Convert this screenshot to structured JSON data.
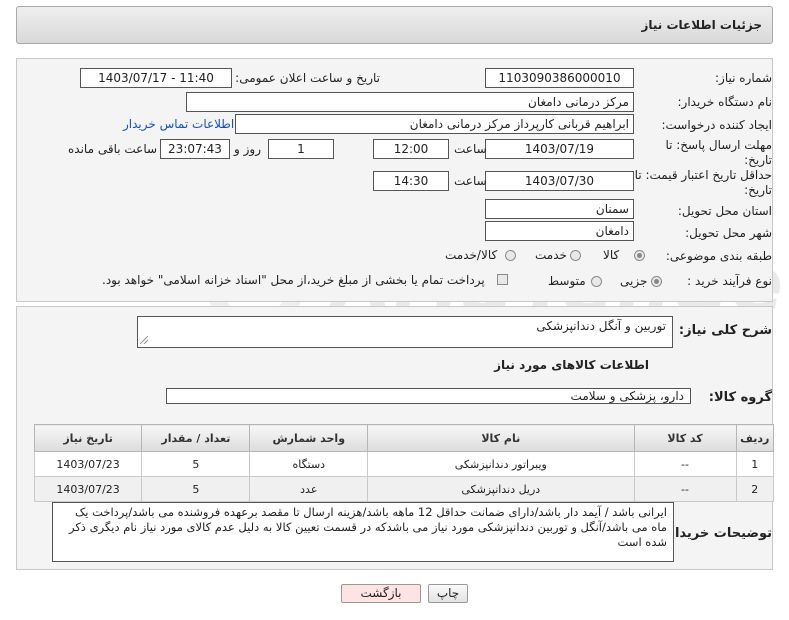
{
  "header": {
    "title": "جزئیات اطلاعات نیاز"
  },
  "form": {
    "need_number_label": "شماره نیاز:",
    "need_number": "1103090386000010",
    "announce_label": "تاریخ و ساعت اعلان عمومی:",
    "announce_value": "1403/07/17 - 11:40",
    "buyer_org_label": "نام دستگاه خریدار:",
    "buyer_org": "مرکز درمانی دامغان",
    "requester_label": "ایجاد کننده درخواست:",
    "requester": "ابراهیم قربانی کارپرداز مرکز درمانی دامغان",
    "contact_link": "اطلاعات تماس خریدار",
    "deadline_label": "مهلت ارسال پاسخ: تا تاریخ:",
    "deadline_date": "1403/07/19",
    "time_label": "ساعت",
    "deadline_time": "12:00",
    "days_value": "1",
    "days_label": "روز و",
    "remaining_time": "23:07:43",
    "remaining_label": "ساعت باقی مانده",
    "validity_label": "حداقل تاریخ اعتبار قیمت: تا تاریخ:",
    "validity_date": "1403/07/30",
    "validity_time": "14:30",
    "province_label": "استان محل تحویل:",
    "province": "سمنان",
    "city_label": "شهر محل تحویل:",
    "city": "دامغان",
    "category_label": "طبقه بندی موضوعی:",
    "category_options": [
      "کالا",
      "خدمت",
      "کالا/خدمت"
    ],
    "process_label": "نوع فرآیند خرید :",
    "process_options": [
      "جزیی",
      "متوسط"
    ],
    "payment_note": "پرداخت تمام یا بخشی از مبلغ خرید،از محل \"اسناد خزانه اسلامی\" خواهد بود."
  },
  "description": {
    "label": "شرح کلی نیاز:",
    "value": "توربین و آنگل دندانپزشکی"
  },
  "goods": {
    "section_title": "اطلاعات کالاهای مورد نیاز",
    "group_label": "گروه کالا:",
    "group_value": "دارو، پزشکی و سلامت",
    "columns": [
      "ردیف",
      "کد کالا",
      "نام کالا",
      "واحد شمارش",
      "تعداد / مقدار",
      "تاریخ نیاز"
    ],
    "rows": [
      [
        "1",
        "--",
        "ویبراتور دندانپزشکی",
        "دستگاه",
        "5",
        "1403/07/23"
      ],
      [
        "2",
        "--",
        "دریل دندانپزشکی",
        "عدد",
        "5",
        "1403/07/23"
      ]
    ]
  },
  "buyer_notes": {
    "label": "توضیحات خریدار:",
    "value": "ایرانی باشد / آیمد دار باشد/دارای ضمانت حداقل 12 ماهه باشد/هزینه ارسال تا مقصد برعهده فروشنده می باشد/پرداخت یک ماه می باشد/آنگل و توربین دندانپزشکی مورد نیاز می باشدکه در قسمت تعیین کالا به دلیل عدم کالای مورد نیاز نام دیگری ذکر شده است"
  },
  "buttons": {
    "print": "چاپ",
    "back": "بازگشت"
  },
  "colors": {
    "link": "#1a4fb5",
    "back_button_bg": "#fde3e3",
    "header_bg": "#dedede"
  }
}
